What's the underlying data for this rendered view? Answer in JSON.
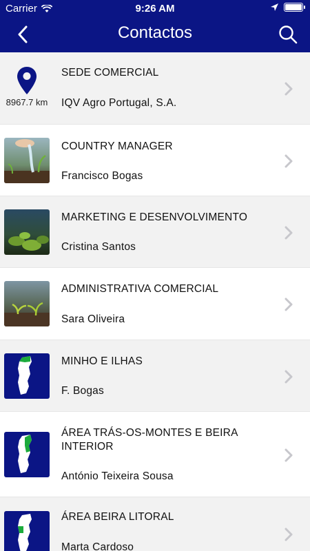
{
  "status_bar": {
    "carrier": "Carrier",
    "time": "9:26 AM"
  },
  "nav": {
    "title": "Contactos"
  },
  "colors": {
    "bar": "#0b1585",
    "map_green": "#1cab3c",
    "pin": "#0b1585"
  },
  "contacts": [
    {
      "role": "SEDE COMERCIAL",
      "name": "IQV Agro Portugal, S.A.",
      "distance": "8967.7 km",
      "icon": "location-pin-icon"
    },
    {
      "role": "COUNTRY MANAGER",
      "name": "Francisco Bogas",
      "icon": "watering-photo"
    },
    {
      "role": "MARKETING E DESENVOLVIMENTO",
      "name": "Cristina Santos",
      "icon": "plants-photo"
    },
    {
      "role": "ADMINISTRATIVA COMERCIAL",
      "name": "Sara Oliveira",
      "icon": "seedlings-photo"
    },
    {
      "role": "MINHO E ILHAS",
      "name": "F. Bogas",
      "icon": "portugal-map-icon"
    },
    {
      "role": "ÁREA TRÁS-OS-MONTES E BEIRA INTERIOR",
      "name": "António Teixeira Sousa",
      "icon": "portugal-map-icon"
    },
    {
      "role": "ÁREA BEIRA LITORAL",
      "name": "Marta Cardoso",
      "icon": "portugal-map-icon"
    }
  ]
}
